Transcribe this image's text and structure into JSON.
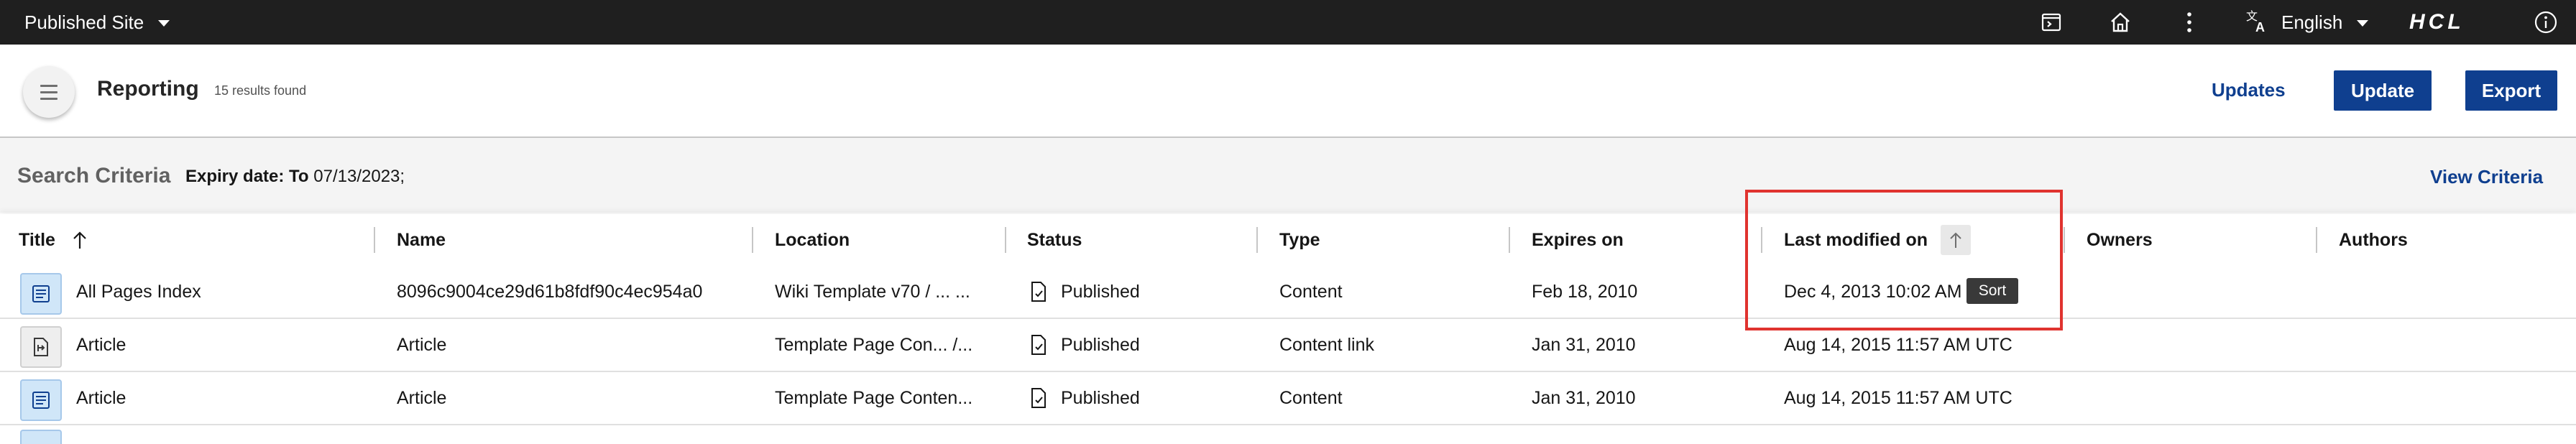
{
  "topbar": {
    "site_selector": "Published Site",
    "language": "English",
    "brand": "HCL",
    "icons": [
      "preview-icon",
      "home-icon",
      "overflow-menu-icon",
      "translate-icon",
      "info-icon"
    ]
  },
  "header": {
    "title": "Reporting",
    "results": "15 results found",
    "updates_label": "Updates",
    "update_label": "Update",
    "export_label": "Export"
  },
  "criteria": {
    "title": "Search Criteria",
    "label": "Expiry date: To",
    "value": "07/13/2023;",
    "view_label": "View Criteria"
  },
  "table": {
    "columns": [
      "Title",
      "Name",
      "Location",
      "Status",
      "Type",
      "Expires on",
      "Last modified on",
      "Owners",
      "Authors"
    ],
    "sorted_column": "Title",
    "rows": [
      {
        "icon": "content-item-icon",
        "title": "All Pages Index",
        "name": "8096c9004ce29d61b8fdf90c4ec954a0",
        "location": "Wiki Template v70 / ... ...",
        "status": "Published",
        "type": "Content",
        "expires": "Feb 18, 2010",
        "modified": "Dec 4, 2013 10:02 AM",
        "owners": "",
        "authors": ""
      },
      {
        "icon": "content-link-icon",
        "title": "Article",
        "name": "Article",
        "location": "Template Page Con... /...",
        "status": "Published",
        "type": "Content link",
        "expires": "Jan 31, 2010",
        "modified": "Aug 14, 2015 11:57 AM UTC",
        "owners": "",
        "authors": ""
      },
      {
        "icon": "content-item-icon",
        "title": "Article",
        "name": "Article",
        "location": "Template Page Conten...",
        "status": "Published",
        "type": "Content",
        "expires": "Jan 31, 2010",
        "modified": "Aug 14, 2015 11:57 AM UTC",
        "owners": "",
        "authors": ""
      }
    ]
  },
  "tooltip": "Sort",
  "colors": {
    "topbar": "#1f1f1f",
    "primary": "#0f3f8f",
    "highlight": "#e0332f"
  }
}
